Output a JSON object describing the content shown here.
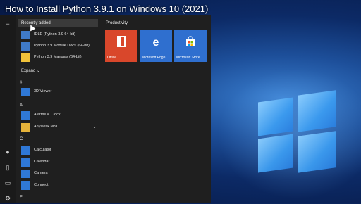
{
  "video_title": "How to Install Python 3.9.1 on Windows 10 (2021)",
  "start_menu": {
    "recent_header": "Recently added",
    "recent_items": [
      {
        "label": "IDLE (Python 3.9 64-bit)",
        "icon": "python-idle-icon"
      },
      {
        "label": "Python 3.9 Module Docs (64-bit)",
        "icon": "python-docs-icon"
      },
      {
        "label": "Python 3.9 Manuals (64-bit)",
        "icon": "python-manuals-icon"
      }
    ],
    "expand_label": "Expand",
    "expand_glyph": "⌄",
    "groups": [
      {
        "letter": "#",
        "items": [
          {
            "label": "3D Viewer",
            "icon": "cube-icon"
          }
        ]
      },
      {
        "letter": "A",
        "items": [
          {
            "label": "Alarms & Clock",
            "icon": "alarm-clock-icon"
          },
          {
            "label": "AnyDesk MSI",
            "icon": "folder-icon",
            "chevron": "⌄"
          }
        ]
      },
      {
        "letter": "C",
        "items": [
          {
            "label": "Calculator",
            "icon": "calculator-icon"
          },
          {
            "label": "Calendar",
            "icon": "calendar-icon"
          },
          {
            "label": "Camera",
            "icon": "camera-icon"
          },
          {
            "label": "Connect",
            "icon": "connect-icon"
          }
        ]
      },
      {
        "letter": "F",
        "items": []
      }
    ],
    "tiles_group": "Productivity",
    "tiles": [
      {
        "label": "Office",
        "icon": "office-icon",
        "color": "#d9472b"
      },
      {
        "label": "Microsoft Edge",
        "icon": "edge-icon",
        "color": "#2f6fcf"
      },
      {
        "label": "Microsoft Store",
        "icon": "store-icon",
        "color": "#2f6fcf"
      }
    ],
    "rail_icons": [
      "hamburger-menu-icon",
      "user-avatar-icon",
      "document-icon",
      "pictures-icon",
      "settings-icon"
    ]
  }
}
